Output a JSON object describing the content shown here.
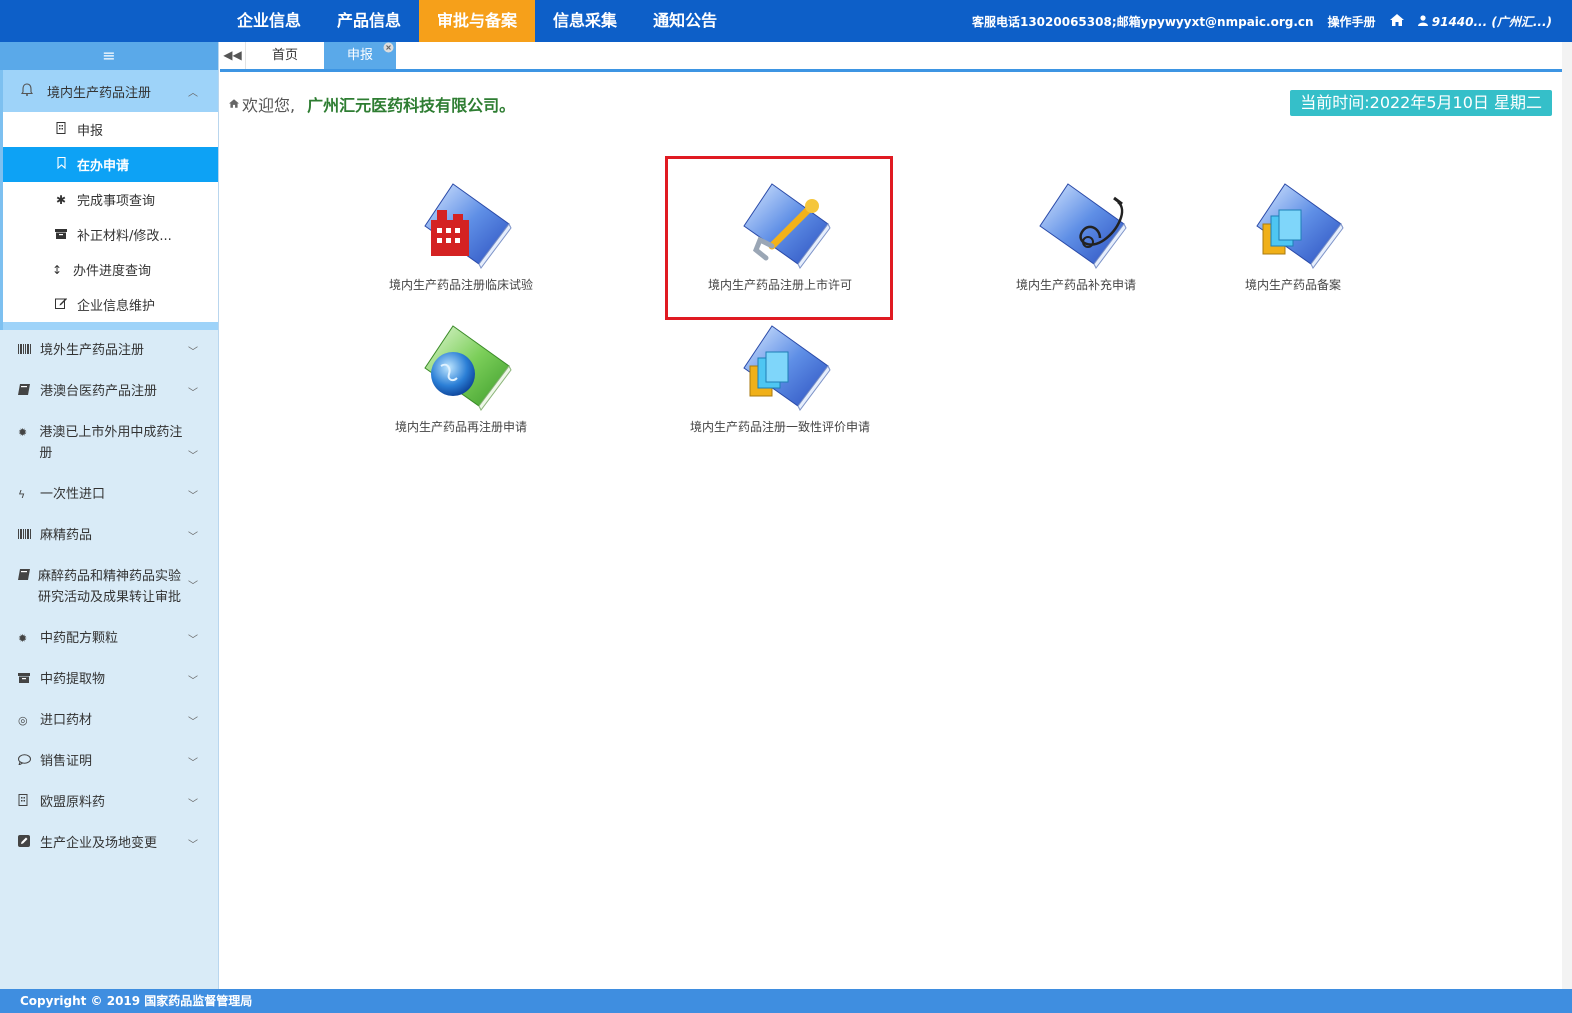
{
  "nav": {
    "items": [
      "企业信息",
      "产品信息",
      "审批与备案",
      "信息采集",
      "通知公告"
    ],
    "active": "审批与备案",
    "contact": "客服电话13020065308;邮箱ypywyyxt@nmpaic.org.cn",
    "manual": "操作手册",
    "user": "91440... (广州汇...)"
  },
  "sidebar": {
    "toggle_icon": "≡",
    "open_group": {
      "label": "境内生产药品注册",
      "icon": "bell-icon",
      "subs": [
        {
          "label": "申报",
          "icon": "building-icon"
        },
        {
          "label": "在办申请",
          "icon": "bookmark-icon",
          "active": true
        },
        {
          "label": "完成事项查询",
          "icon": "asterisk-icon"
        },
        {
          "label": "补正材料/修改...",
          "icon": "archive-icon"
        },
        {
          "label": "办件进度查询",
          "icon": "arrows-vertical-icon"
        },
        {
          "label": "企业信息维护",
          "icon": "edit-icon"
        }
      ]
    },
    "groups": [
      {
        "label": "境外生产药品注册",
        "icon": "barcode-icon"
      },
      {
        "label": "港澳台医药产品注册",
        "icon": "book-icon"
      },
      {
        "label": "港澳已上市外用中成药注册",
        "icon": "certificate-icon"
      },
      {
        "label": "一次性进口",
        "icon": "bolt-icon"
      },
      {
        "label": "麻精药品",
        "icon": "barcode-icon"
      },
      {
        "label": "麻醉药品和精神药品实验研究活动及成果转让审批",
        "icon": "book-icon"
      },
      {
        "label": "中药配方颗粒",
        "icon": "certificate-icon"
      },
      {
        "label": "中药提取物",
        "icon": "archive-icon"
      },
      {
        "label": "进口药材",
        "icon": "dot-circle-icon"
      },
      {
        "label": "销售证明",
        "icon": "comment-icon"
      },
      {
        "label": "欧盟原料药",
        "icon": "building-icon"
      },
      {
        "label": "生产企业及场地变更",
        "icon": "pencil-square-icon"
      }
    ]
  },
  "tabs": {
    "back_icon": "double-left-icon",
    "home": "首页",
    "current": "申报",
    "close": "×"
  },
  "main": {
    "welcome_prefix": "欢迎您,",
    "company": "广州汇元医药科技有限公司。",
    "time": "当前时间:2022年5月10日 星期二",
    "tiles": [
      {
        "label": "境内生产药品注册临床试验",
        "icon": "book-factory-icon"
      },
      {
        "label": "境内生产药品注册上市许可",
        "icon": "book-wrench-icon"
      },
      {
        "label": "境内生产药品补充申请",
        "icon": "book-stethoscope-icon"
      },
      {
        "label": "境内生产药品备案",
        "icon": "book-documents-icon"
      },
      {
        "label": "境内生产药品再注册申请",
        "icon": "book-globe-icon"
      },
      {
        "label": "境内生产药品注册一致性评价申请",
        "icon": "book-documents-icon"
      }
    ]
  },
  "footer": {
    "text": "Copyright © 2019 国家药品监督管理局"
  },
  "colors": {
    "topbar": "#0d5fc8",
    "active_nav": "#f6a01a",
    "sidebar_bg": "#d9ebf7",
    "active_sub": "#0da2f5",
    "time_box": "#35bfc9",
    "highlight": "#e01a22"
  }
}
